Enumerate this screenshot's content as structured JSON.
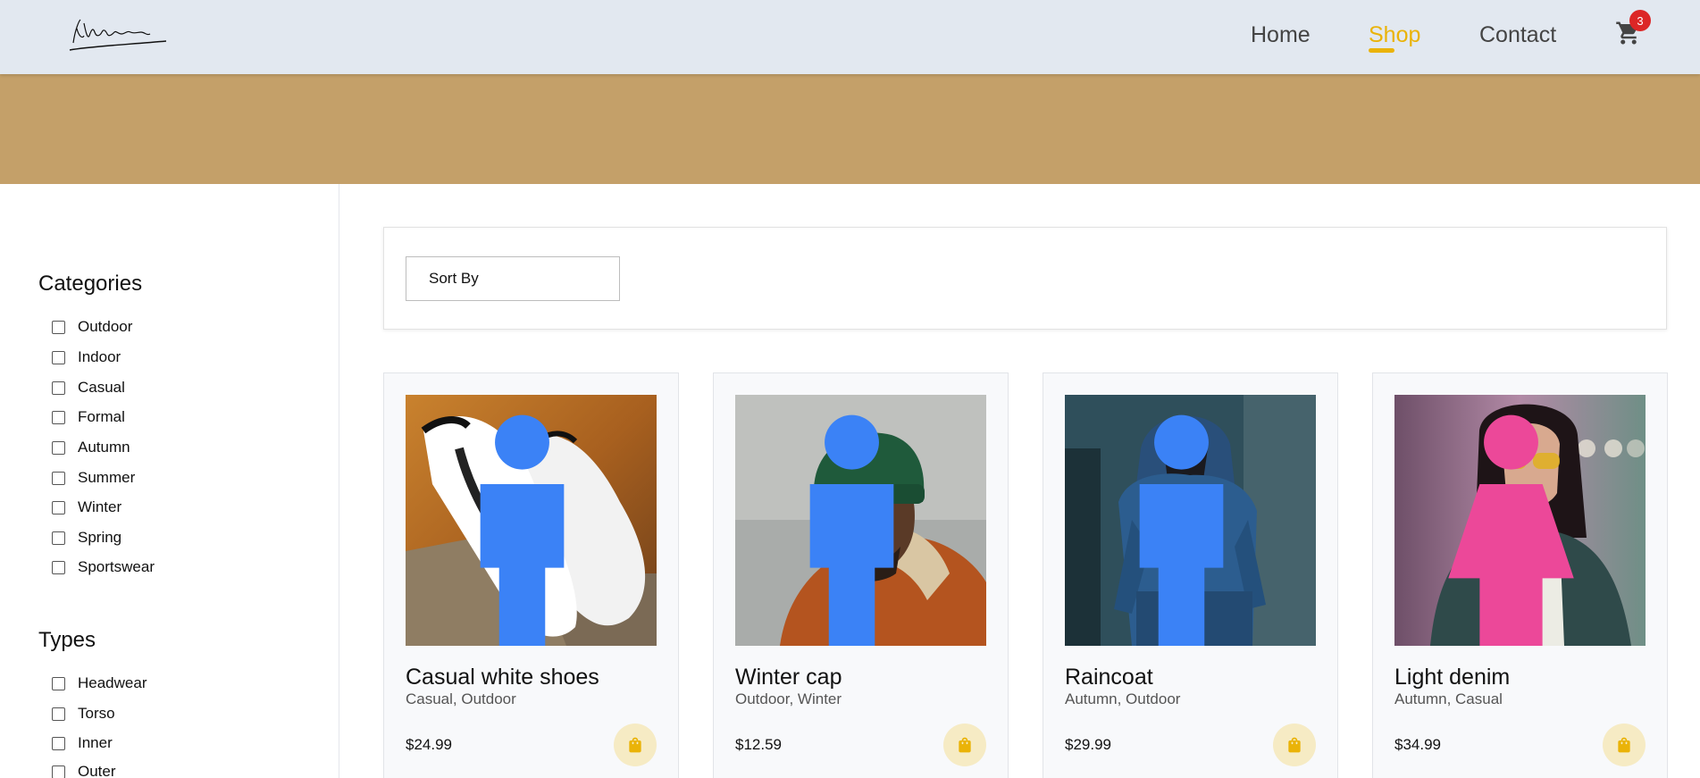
{
  "header": {
    "logo_alt": "signature logo",
    "nav": [
      {
        "label": "Home",
        "active": false
      },
      {
        "label": "Shop",
        "active": true
      },
      {
        "label": "Contact",
        "active": false
      }
    ],
    "cart_icon": "shopping-cart-icon",
    "cart_count": "3",
    "accent_color": "#eab308"
  },
  "banner": {
    "color": "#c4a069"
  },
  "sidebar": {
    "categories_title": "Categories",
    "categories": [
      "Outdoor",
      "Indoor",
      "Casual",
      "Formal",
      "Autumn",
      "Summer",
      "Winter",
      "Spring",
      "Sportswear"
    ],
    "types_title": "Types",
    "types": [
      "Headwear",
      "Torso",
      "Inner",
      "Outer"
    ]
  },
  "sort": {
    "label": "Sort By"
  },
  "products": [
    {
      "title": "Casual white shoes",
      "tags": "Casual, Outdoor",
      "price": "$24.99",
      "gender": "male",
      "gender_icon": "male-icon",
      "cart_icon": "shopping-bag-icon"
    },
    {
      "title": "Winter cap",
      "tags": "Outdoor, Winter",
      "price": "$12.59",
      "gender": "male",
      "gender_icon": "male-icon",
      "cart_icon": "shopping-bag-icon"
    },
    {
      "title": "Raincoat",
      "tags": "Autumn, Outdoor",
      "price": "$29.99",
      "gender": "male",
      "gender_icon": "male-icon",
      "cart_icon": "shopping-bag-icon"
    },
    {
      "title": "Light denim",
      "tags": "Autumn, Casual",
      "price": "$34.99",
      "gender": "female",
      "gender_icon": "female-icon",
      "cart_icon": "shopping-bag-icon"
    }
  ]
}
